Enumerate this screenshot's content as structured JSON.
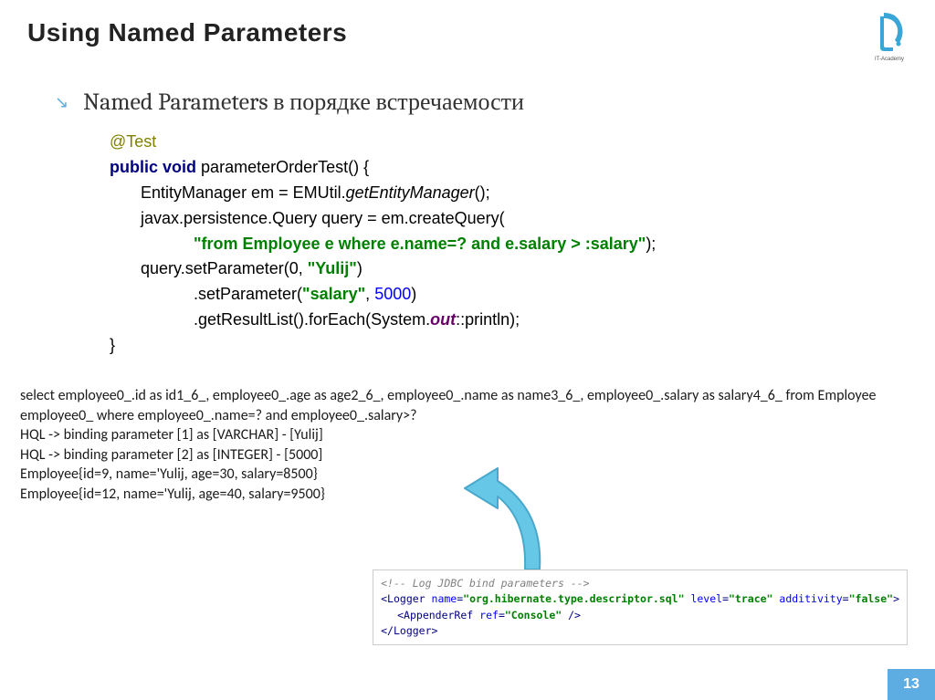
{
  "title": "Using Named Parameters",
  "bullet": "Named Parameters в порядке встречаемости",
  "code": {
    "annotation": "@Test",
    "kw_public": "public",
    "kw_void": "void",
    "method": "parameterOrderTest",
    "l2a": "EntityManager em = EMUtil.",
    "l2b": "getEntityManager",
    "l3": "javax.persistence.Query query = em.createQuery(",
    "str1": "\"from Employee e where e.name=? and e.salary > :salary\"",
    "l5a": "query.setParameter(0, ",
    "str2": "\"Yulij\"",
    "l6a": ".setParameter(",
    "str3": "\"salary\"",
    "num1": "5000",
    "l7a": ".getResultList().forEach(System.",
    "out": "out",
    "l7b": "::println);"
  },
  "output": {
    "l1": "select employee0_.id as id1_6_, employee0_.age as age2_6_, employee0_.name as name3_6_, employee0_.salary as salary4_6_ from Employee employee0_ where employee0_.name=? and employee0_.salary>?",
    "l2": "HQL -> binding parameter [1] as [VARCHAR] - [Yulij]",
    "l3": "HQL -> binding parameter [2] as [INTEGER] - [5000]",
    "l4": "Employee{id=9, name='Yulij, age=30, salary=8500}",
    "l5": "Employee{id=12, name='Yulij, age=40, salary=9500}"
  },
  "xml": {
    "comment": "<!-- Log JDBC bind parameters -->",
    "logger_open": "Logger",
    "attr_name_n": "name",
    "attr_name_v": "\"org.hibernate.type.descriptor.sql\"",
    "attr_level_n": "level",
    "attr_level_v": "\"trace\"",
    "attr_add_n": "additivity",
    "attr_add_v": "\"false\"",
    "appender": "AppenderRef",
    "attr_ref_n": "ref",
    "attr_ref_v": "\"Console\""
  },
  "logo_label": "IT-Academy",
  "page": "13"
}
